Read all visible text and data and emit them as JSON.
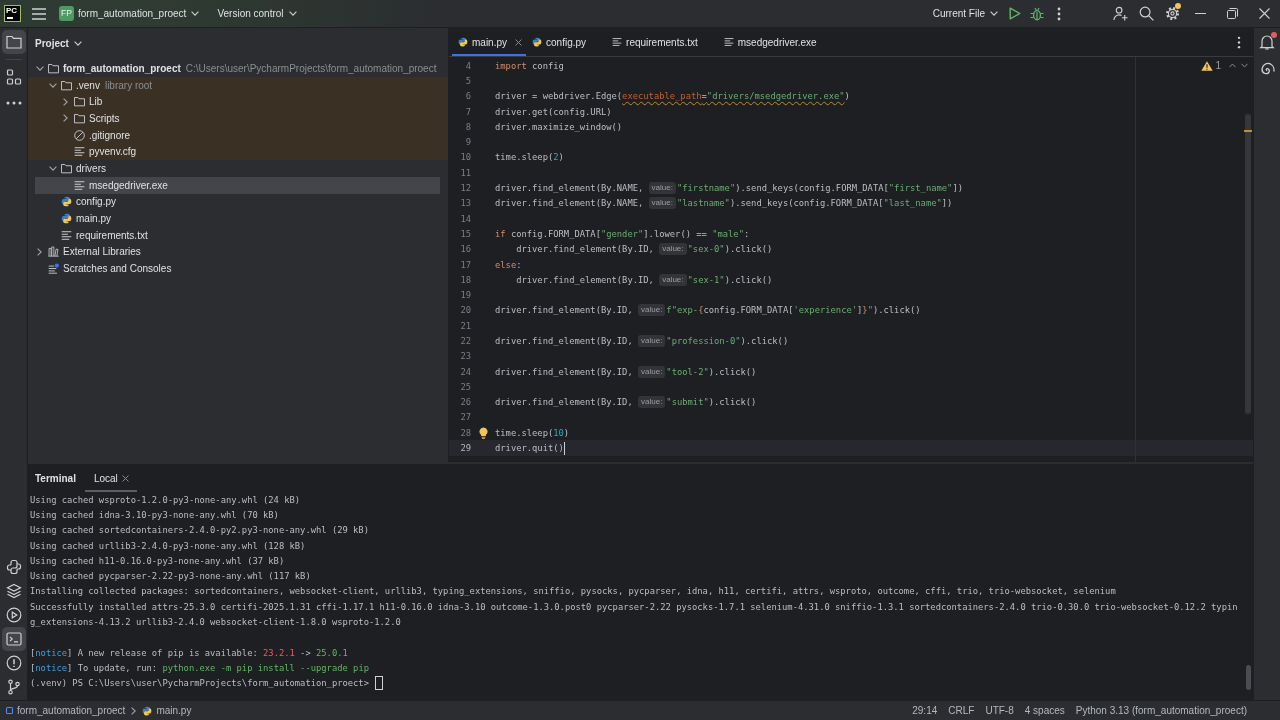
{
  "title_bar": {
    "logo": "PC",
    "project_badge": "FP",
    "project": "form_automation_proect",
    "vcs": "Version control",
    "run_config": "Current File",
    "settings_badge": true
  },
  "tool_strip": {
    "top": [
      {
        "kind": "project",
        "selected": true
      },
      {
        "kind": "structure",
        "selected": false
      },
      {
        "kind": "more",
        "selected": false
      }
    ],
    "bottom": [
      {
        "kind": "python-console",
        "selected": false
      },
      {
        "kind": "layers",
        "selected": false
      },
      {
        "kind": "services",
        "selected": false
      },
      {
        "kind": "terminal",
        "selected": true
      },
      {
        "kind": "problems",
        "selected": false
      },
      {
        "kind": "git",
        "selected": false
      }
    ]
  },
  "project_panel": {
    "title": "Project",
    "tree": [
      {
        "label": "form_automation_proect",
        "kind": "root",
        "hint": "C:\\Users\\user\\PycharmProjects\\form_automation_proect",
        "expanded": true,
        "selected": false,
        "highlighted": false,
        "children": [
          {
            "label": ".venv",
            "kind": "folder",
            "hint": "library root",
            "expanded": true,
            "selected": false,
            "highlighted": true,
            "children": [
              {
                "label": "Lib",
                "kind": "folder",
                "expanded": false,
                "selected": false,
                "highlighted": true
              },
              {
                "label": "Scripts",
                "kind": "folder",
                "expanded": false,
                "selected": false,
                "highlighted": true
              },
              {
                "label": ".gitignore",
                "kind": "ignore",
                "selected": false,
                "highlighted": true
              },
              {
                "label": "pyvenv.cfg",
                "kind": "text",
                "selected": false,
                "highlighted": true
              }
            ]
          },
          {
            "label": "drivers",
            "kind": "folder",
            "expanded": true,
            "selected": false,
            "highlighted": false,
            "children": [
              {
                "label": "msedgedriver.exe",
                "kind": "text",
                "selected": true,
                "highlighted": false
              }
            ]
          },
          {
            "label": "config.py",
            "kind": "python",
            "selected": false,
            "highlighted": false
          },
          {
            "label": "main.py",
            "kind": "python",
            "selected": false,
            "highlighted": false
          },
          {
            "label": "requirements.txt",
            "kind": "text",
            "selected": false,
            "highlighted": false
          }
        ]
      },
      {
        "label": "External Libraries",
        "kind": "library",
        "expanded": false,
        "selected": false,
        "highlighted": false
      },
      {
        "label": "Scratches and Consoles",
        "kind": "scratches",
        "selected": false,
        "highlighted": false
      }
    ]
  },
  "editor": {
    "tabs": [
      {
        "label": "main.py",
        "kind": "python",
        "selected": true
      },
      {
        "label": "config.py",
        "kind": "python",
        "selected": false
      },
      {
        "label": "requirements.txt",
        "kind": "text",
        "selected": false
      },
      {
        "label": "msedgedriver.exe",
        "kind": "text",
        "selected": false
      }
    ],
    "warnings": "1",
    "lines": [
      {
        "number": "4",
        "current": false,
        "bulb": false,
        "segments": [
          {
            "kind": "keyword",
            "text": "import"
          },
          {
            "kind": "plain",
            "text": " config"
          }
        ]
      },
      {
        "number": "5",
        "current": false,
        "bulb": false
      },
      {
        "number": "6",
        "current": false,
        "bulb": false,
        "segments": [
          {
            "kind": "plain",
            "text": "driver = webdriver.Edge("
          },
          {
            "kind": "warning",
            "parts": [
              {
                "kind": "param",
                "text": "executable_path"
              },
              {
                "kind": "plain",
                "text": "="
              },
              {
                "kind": "string",
                "text": "\"drivers/msedgedriver.exe\""
              }
            ]
          },
          {
            "kind": "plain",
            "text": ")"
          }
        ]
      },
      {
        "number": "7",
        "current": false,
        "bulb": false,
        "segments": [
          {
            "kind": "plain",
            "text": "driver.get(config.URL)"
          }
        ]
      },
      {
        "number": "8",
        "current": false,
        "bulb": false,
        "segments": [
          {
            "kind": "plain",
            "text": "driver.maximize_window()"
          }
        ]
      },
      {
        "number": "9",
        "current": false,
        "bulb": false
      },
      {
        "number": "10",
        "current": false,
        "bulb": false,
        "segments": [
          {
            "kind": "plain",
            "text": "time.sleep("
          },
          {
            "kind": "number",
            "text": "2"
          },
          {
            "kind": "plain",
            "text": ")"
          }
        ]
      },
      {
        "number": "11",
        "current": false,
        "bulb": false
      },
      {
        "number": "12",
        "current": false,
        "bulb": false,
        "segments": [
          {
            "kind": "plain",
            "text": "driver.find_element(By.NAME, "
          },
          {
            "kind": "hint",
            "text": "value:"
          },
          {
            "kind": "string",
            "text": "\"firstname\""
          },
          {
            "kind": "plain",
            "text": ").send_keys(config.FORM_DATA["
          },
          {
            "kind": "string",
            "text": "\"first_name\""
          },
          {
            "kind": "plain",
            "text": "])"
          }
        ]
      },
      {
        "number": "13",
        "current": false,
        "bulb": false,
        "segments": [
          {
            "kind": "plain",
            "text": "driver.find_element(By.NAME, "
          },
          {
            "kind": "hint",
            "text": "value:"
          },
          {
            "kind": "string",
            "text": "\"lastname\""
          },
          {
            "kind": "plain",
            "text": ").send_keys(config.FORM_DATA["
          },
          {
            "kind": "string",
            "text": "\"last_name\""
          },
          {
            "kind": "plain",
            "text": "])"
          }
        ]
      },
      {
        "number": "14",
        "current": false,
        "bulb": false
      },
      {
        "number": "15",
        "current": false,
        "bulb": false,
        "segments": [
          {
            "kind": "keyword",
            "text": "if"
          },
          {
            "kind": "plain",
            "text": " config.FORM_DATA["
          },
          {
            "kind": "string",
            "text": "\"gender\""
          },
          {
            "kind": "plain",
            "text": "].lower() == "
          },
          {
            "kind": "string",
            "text": "\"male\""
          },
          {
            "kind": "plain",
            "text": ":"
          }
        ]
      },
      {
        "number": "16",
        "current": false,
        "bulb": false,
        "segments": [
          {
            "kind": "plain",
            "text": "    driver.find_element(By.ID, "
          },
          {
            "kind": "hint",
            "text": "value:"
          },
          {
            "kind": "string",
            "text": "\"sex-0\""
          },
          {
            "kind": "plain",
            "text": ").click()"
          }
        ]
      },
      {
        "number": "17",
        "current": false,
        "bulb": false,
        "segments": [
          {
            "kind": "keyword",
            "text": "else"
          },
          {
            "kind": "plain",
            "text": ":"
          }
        ]
      },
      {
        "number": "18",
        "current": false,
        "bulb": false,
        "segments": [
          {
            "kind": "plain",
            "text": "    driver.find_element(By.ID, "
          },
          {
            "kind": "hint",
            "text": "value:"
          },
          {
            "kind": "string",
            "text": "\"sex-1\""
          },
          {
            "kind": "plain",
            "text": ").click()"
          }
        ]
      },
      {
        "number": "19",
        "current": false,
        "bulb": false
      },
      {
        "number": "20",
        "current": false,
        "bulb": false,
        "segments": [
          {
            "kind": "plain",
            "text": "driver.find_element(By.ID, "
          },
          {
            "kind": "hint",
            "text": "value:"
          },
          {
            "kind": "string",
            "text": "f\"exp-"
          },
          {
            "kind": "brace",
            "text": "{"
          },
          {
            "kind": "plain",
            "text": "config.FORM_DATA["
          },
          {
            "kind": "string",
            "text": "'experience'"
          },
          {
            "kind": "plain",
            "text": "]"
          },
          {
            "kind": "brace",
            "text": "}"
          },
          {
            "kind": "string",
            "text": "\""
          },
          {
            "kind": "plain",
            "text": ").click()"
          }
        ]
      },
      {
        "number": "21",
        "current": false,
        "bulb": false
      },
      {
        "number": "22",
        "current": false,
        "bulb": false,
        "segments": [
          {
            "kind": "plain",
            "text": "driver.find_element(By.ID, "
          },
          {
            "kind": "hint",
            "text": "value:"
          },
          {
            "kind": "string",
            "text": "\"profession-0\""
          },
          {
            "kind": "plain",
            "text": ").click()"
          }
        ]
      },
      {
        "number": "23",
        "current": false,
        "bulb": false
      },
      {
        "number": "24",
        "current": false,
        "bulb": false,
        "segments": [
          {
            "kind": "plain",
            "text": "driver.find_element(By.ID, "
          },
          {
            "kind": "hint",
            "text": "value:"
          },
          {
            "kind": "string",
            "text": "\"tool-2\""
          },
          {
            "kind": "plain",
            "text": ").click()"
          }
        ]
      },
      {
        "number": "25",
        "current": false,
        "bulb": false
      },
      {
        "number": "26",
        "current": false,
        "bulb": false,
        "segments": [
          {
            "kind": "plain",
            "text": "driver.find_element(By.ID, "
          },
          {
            "kind": "hint",
            "text": "value:"
          },
          {
            "kind": "string",
            "text": "\"submit\""
          },
          {
            "kind": "plain",
            "text": ").click()"
          }
        ]
      },
      {
        "number": "27",
        "current": false,
        "bulb": false
      },
      {
        "number": "28",
        "current": false,
        "bulb": true,
        "segments": [
          {
            "kind": "plain",
            "text": "time.sleep("
          },
          {
            "kind": "number",
            "text": "10"
          },
          {
            "kind": "plain",
            "text": ")"
          }
        ]
      },
      {
        "number": "29",
        "current": true,
        "bulb": false,
        "segments": [
          {
            "kind": "plain",
            "text": "driver.quit()"
          }
        ]
      }
    ]
  },
  "right_strip": [
    {
      "kind": "notifications",
      "badge": true
    },
    {
      "kind": "ai-assistant",
      "badge": false
    }
  ],
  "terminal": {
    "title": "Terminal",
    "tabs": [
      {
        "label": "Local",
        "selected": true
      }
    ],
    "lines": [
      {
        "kind": "output",
        "segments": [
          {
            "kind": "plain",
            "text": "Using cached wsproto-1.2.0-py3-none-any.whl (24 kB)"
          }
        ]
      },
      {
        "kind": "output",
        "segments": [
          {
            "kind": "plain",
            "text": "Using cached idna-3.10-py3-none-any.whl (70 kB)"
          }
        ]
      },
      {
        "kind": "output",
        "segments": [
          {
            "kind": "plain",
            "text": "Using cached sortedcontainers-2.4.0-py2.py3-none-any.whl (29 kB)"
          }
        ]
      },
      {
        "kind": "output",
        "segments": [
          {
            "kind": "plain",
            "text": "Using cached urllib3-2.4.0-py3-none-any.whl (128 kB)"
          }
        ]
      },
      {
        "kind": "output",
        "segments": [
          {
            "kind": "plain",
            "text": "Using cached h11-0.16.0-py3-none-any.whl (37 kB)"
          }
        ]
      },
      {
        "kind": "output",
        "segments": [
          {
            "kind": "plain",
            "text": "Using cached pycparser-2.22-py3-none-any.whl (117 kB)"
          }
        ]
      },
      {
        "kind": "output",
        "segments": [
          {
            "kind": "plain",
            "text": "Installing collected packages: sortedcontainers, websocket-client, urllib3, typing_extensions, sniffio, pysocks, pycparser, idna, h11, certifi, attrs, wsproto, outcome, cffi, trio, trio-websocket, selenium"
          }
        ]
      },
      {
        "kind": "output",
        "segments": [
          {
            "kind": "plain",
            "text": "Successfully installed attrs-25.3.0 certifi-2025.1.31 cffi-1.17.1 h11-0.16.0 idna-3.10 outcome-1.3.0.post0 pycparser-2.22 pysocks-1.7.1 selenium-4.31.0 sniffio-1.3.1 sortedcontainers-2.4.0 trio-0.30.0 trio-websocket-0.12.2 typin"
          }
        ]
      },
      {
        "kind": "output",
        "segments": [
          {
            "kind": "plain",
            "text": "g_extensions-4.13.2 urllib3-2.4.0 websocket-client-1.8.0 wsproto-1.2.0"
          }
        ]
      },
      {
        "kind": "blank"
      },
      {
        "kind": "output",
        "segments": [
          {
            "kind": "plain",
            "text": "["
          },
          {
            "kind": "info",
            "text": "notice"
          },
          {
            "kind": "plain",
            "text": "] A new release of pip is available: "
          },
          {
            "kind": "error",
            "text": "23.2.1"
          },
          {
            "kind": "plain",
            "text": " -> "
          },
          {
            "kind": "success",
            "text": "25.0.1"
          }
        ]
      },
      {
        "kind": "output",
        "segments": [
          {
            "kind": "plain",
            "text": "["
          },
          {
            "kind": "info",
            "text": "notice"
          },
          {
            "kind": "plain",
            "text": "] To update, run: "
          },
          {
            "kind": "success",
            "text": "python.exe -m pip install --upgrade pip"
          }
        ]
      },
      {
        "kind": "prompt",
        "segments": [
          {
            "kind": "plain",
            "text": "(.venv) PS C:\\Users\\user\\PycharmProjects\\form_automation_proect>"
          }
        ]
      }
    ]
  },
  "status_bar": {
    "breadcrumbs": [
      {
        "kind": "module",
        "label": "form_automation_proect"
      },
      {
        "kind": "python",
        "label": "main.py"
      }
    ],
    "items": [
      "29:14",
      "CRLF",
      "UTF-8",
      "4 spaces",
      "Python 3.13 (form_automation_proect)"
    ]
  }
}
